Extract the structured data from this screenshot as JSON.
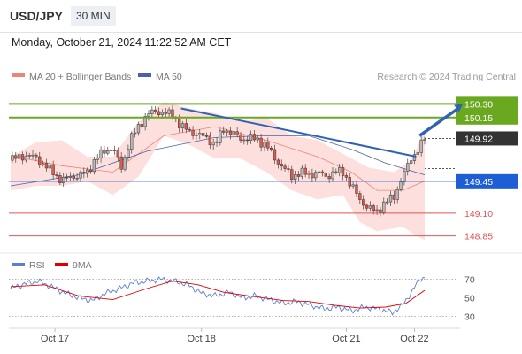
{
  "header": {
    "symbol": "USD/JPY",
    "timeframe": "30 MIN"
  },
  "timestamp": "Monday, October 21, 2024 11:22:52 AM CET",
  "legend": {
    "bb_label": "MA 20 + Bollinger Bands",
    "ma50_label": "MA 50",
    "credit": "Research © 2024 Trading Central"
  },
  "rsi_legend": {
    "rsi_label": "RSI",
    "ma_label": "9MA"
  },
  "colors": {
    "up": "#cccccc",
    "down": "#e25a4c",
    "bb_fill": "#fcd6d2",
    "ma20": "#ef8577",
    "ma50": "#4a63a8",
    "resistance": "#6aa820",
    "pivot": "#1e5ed4",
    "support": "#e05555",
    "arrow": "#2f63b2"
  },
  "chart_data": [
    {
      "type": "candlestick",
      "instrument": "USD/JPY",
      "interval": "30 MIN",
      "x_ticks": [
        "Oct 17",
        "Oct 18",
        "Oct 21",
        "Oct 22"
      ],
      "ylim": [
        148.7,
        150.42
      ],
      "levels": [
        {
          "value": 150.3,
          "label": "150.30",
          "kind": "resistance"
        },
        {
          "value": 150.15,
          "label": "150.15",
          "kind": "resistance"
        },
        {
          "value": 149.92,
          "label": "149.92",
          "kind": "last"
        },
        {
          "value": 149.45,
          "label": "149.45",
          "kind": "pivot"
        },
        {
          "value": 149.1,
          "label": "149.10",
          "kind": "support"
        },
        {
          "value": 148.85,
          "label": "148.85",
          "kind": "support"
        }
      ],
      "close_path": [
        [
          0,
          149.68
        ],
        [
          5,
          149.72
        ],
        [
          10,
          149.73
        ],
        [
          15,
          149.71
        ],
        [
          20,
          149.62
        ],
        [
          25,
          149.55
        ],
        [
          30,
          149.45
        ],
        [
          35,
          149.5
        ],
        [
          40,
          149.51
        ],
        [
          45,
          149.55
        ],
        [
          50,
          149.7
        ],
        [
          55,
          149.78
        ],
        [
          60,
          149.82
        ],
        [
          65,
          149.6
        ],
        [
          70,
          149.9
        ],
        [
          75,
          150.05
        ],
        [
          80,
          150.18
        ],
        [
          85,
          150.22
        ],
        [
          90,
          150.2
        ],
        [
          95,
          150.18
        ],
        [
          100,
          150.05
        ],
        [
          105,
          150.0
        ],
        [
          110,
          149.96
        ],
        [
          115,
          149.93
        ],
        [
          120,
          149.85
        ],
        [
          125,
          150.02
        ],
        [
          130,
          149.98
        ],
        [
          135,
          149.91
        ],
        [
          140,
          149.93
        ],
        [
          145,
          149.9
        ],
        [
          150,
          149.85
        ],
        [
          155,
          149.7
        ],
        [
          160,
          149.6
        ],
        [
          165,
          149.5
        ],
        [
          170,
          149.55
        ],
        [
          175,
          149.52
        ],
        [
          180,
          149.55
        ],
        [
          185,
          149.5
        ],
        [
          190,
          149.55
        ],
        [
          195,
          149.55
        ],
        [
          200,
          149.4
        ],
        [
          205,
          149.25
        ],
        [
          210,
          149.15
        ],
        [
          215,
          149.12
        ],
        [
          220,
          149.22
        ],
        [
          225,
          149.28
        ],
        [
          230,
          149.5
        ],
        [
          235,
          149.7
        ],
        [
          240,
          149.82
        ],
        [
          243,
          149.92
        ]
      ],
      "ma20": [
        [
          0,
          149.73
        ],
        [
          30,
          149.62
        ],
        [
          60,
          149.55
        ],
        [
          90,
          149.95
        ],
        [
          120,
          150.05
        ],
        [
          150,
          149.9
        ],
        [
          180,
          149.72
        ],
        [
          200,
          149.55
        ],
        [
          215,
          149.35
        ],
        [
          230,
          149.35
        ],
        [
          243,
          149.45
        ]
      ],
      "bb_upper": [
        [
          0,
          149.72
        ],
        [
          15,
          149.88
        ],
        [
          30,
          149.9
        ],
        [
          45,
          149.72
        ],
        [
          60,
          149.72
        ],
        [
          75,
          150.1
        ],
        [
          90,
          150.32
        ],
        [
          105,
          150.25
        ],
        [
          120,
          150.2
        ],
        [
          135,
          150.1
        ],
        [
          150,
          150.15
        ],
        [
          165,
          149.95
        ],
        [
          180,
          149.9
        ],
        [
          195,
          149.75
        ],
        [
          210,
          149.6
        ],
        [
          225,
          149.55
        ],
        [
          235,
          149.68
        ],
        [
          243,
          150.0
        ]
      ],
      "bb_lower": [
        [
          0,
          149.35
        ],
        [
          15,
          149.4
        ],
        [
          30,
          149.4
        ],
        [
          45,
          149.45
        ],
        [
          60,
          149.3
        ],
        [
          75,
          149.5
        ],
        [
          90,
          149.95
        ],
        [
          105,
          149.85
        ],
        [
          120,
          149.7
        ],
        [
          135,
          149.7
        ],
        [
          150,
          149.55
        ],
        [
          165,
          149.35
        ],
        [
          180,
          149.25
        ],
        [
          195,
          149.3
        ],
        [
          205,
          149.0
        ],
        [
          215,
          148.9
        ],
        [
          230,
          148.95
        ],
        [
          243,
          148.8
        ]
      ],
      "ma50": [
        [
          0,
          149.4
        ],
        [
          40,
          149.52
        ],
        [
          80,
          149.78
        ],
        [
          120,
          149.93
        ],
        [
          150,
          149.95
        ],
        [
          175,
          149.95
        ],
        [
          200,
          149.8
        ],
        [
          220,
          149.65
        ],
        [
          243,
          149.52
        ]
      ],
      "trendlines": [
        {
          "from": [
            100,
            150.25
          ],
          "to": [
            238,
            149.72
          ]
        }
      ],
      "forecast_arrow": {
        "from": [
          240,
          149.95
        ],
        "to": [
          255,
          150.3
        ]
      }
    },
    {
      "type": "line",
      "indicator": "RSI",
      "ylim": [
        20,
        80
      ],
      "y_ticks": [
        70,
        50,
        30
      ],
      "series": [
        {
          "name": "RSI",
          "points": [
            [
              0,
              60
            ],
            [
              8,
              65
            ],
            [
              16,
              68
            ],
            [
              24,
              62
            ],
            [
              32,
              55
            ],
            [
              40,
              50
            ],
            [
              48,
              47
            ],
            [
              56,
              55
            ],
            [
              64,
              60
            ],
            [
              72,
              66
            ],
            [
              80,
              68
            ],
            [
              88,
              70
            ],
            [
              96,
              68
            ],
            [
              104,
              64
            ],
            [
              112,
              55
            ],
            [
              120,
              52
            ],
            [
              128,
              56
            ],
            [
              136,
              50
            ],
            [
              144,
              52
            ],
            [
              152,
              48
            ],
            [
              160,
              44
            ],
            [
              168,
              46
            ],
            [
              176,
              42
            ],
            [
              184,
              38
            ],
            [
              192,
              40
            ],
            [
              200,
              36
            ],
            [
              208,
              40
            ],
            [
              216,
              38
            ],
            [
              224,
              34
            ],
            [
              230,
              42
            ],
            [
              236,
              58
            ],
            [
              240,
              70
            ],
            [
              243,
              72
            ]
          ]
        },
        {
          "name": "9MA",
          "points": [
            [
              0,
              62
            ],
            [
              20,
              64
            ],
            [
              40,
              52
            ],
            [
              60,
              48
            ],
            [
              80,
              60
            ],
            [
              95,
              68
            ],
            [
              110,
              64
            ],
            [
              125,
              56
            ],
            [
              140,
              52
            ],
            [
              160,
              47
            ],
            [
              175,
              46
            ],
            [
              190,
              42
            ],
            [
              205,
              39
            ],
            [
              220,
              40
            ],
            [
              232,
              44
            ],
            [
              243,
              58
            ]
          ]
        }
      ]
    }
  ]
}
